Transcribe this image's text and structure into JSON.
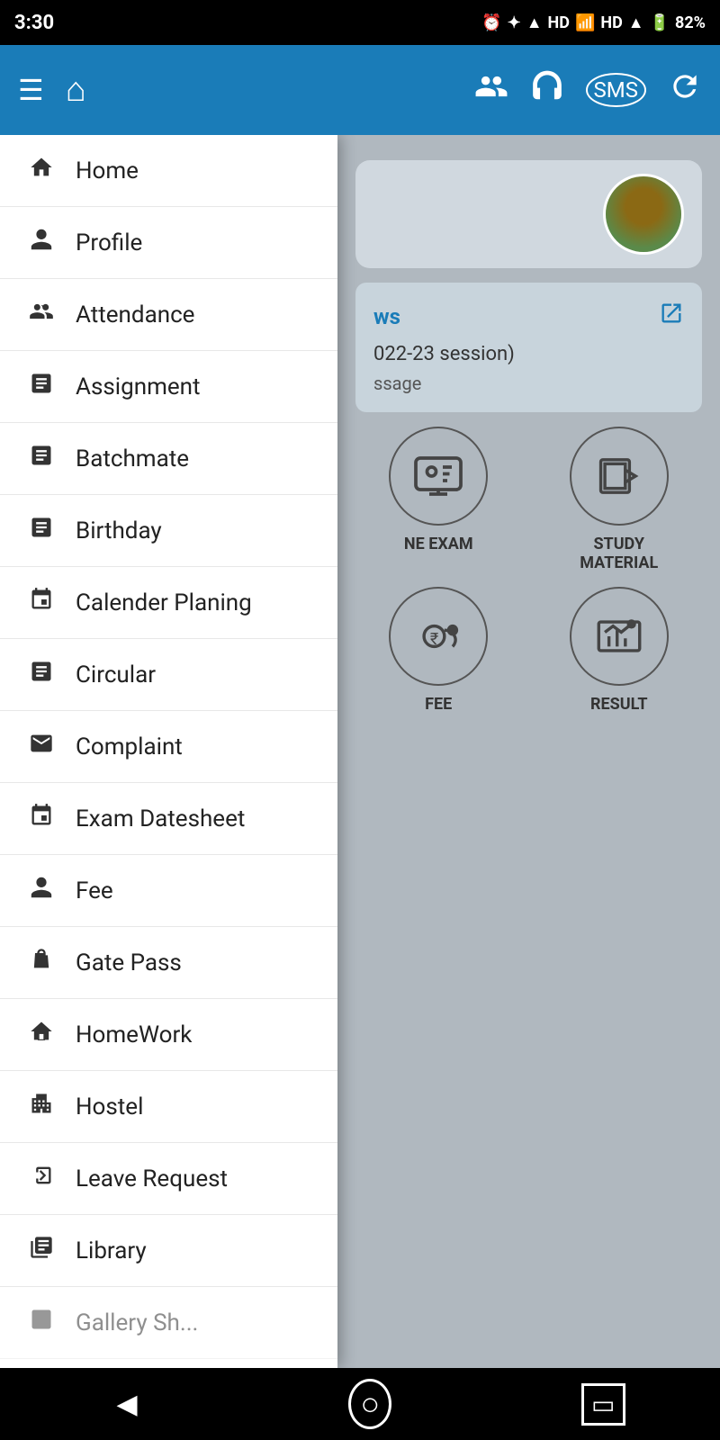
{
  "status_bar": {
    "time": "3:30",
    "battery": "82%",
    "signal": "HD"
  },
  "app_bar": {
    "menu_icon": "☰",
    "home_icon": "⌂"
  },
  "nav_items": [
    {
      "id": "home",
      "label": "Home",
      "icon": "🏠"
    },
    {
      "id": "profile",
      "label": "Profile",
      "icon": "👤"
    },
    {
      "id": "attendance",
      "label": "Attendance",
      "icon": "👥"
    },
    {
      "id": "assignment",
      "label": "Assignment",
      "icon": "📋"
    },
    {
      "id": "batchmate",
      "label": "Batchmate",
      "icon": "📋"
    },
    {
      "id": "birthday",
      "label": "Birthday",
      "icon": "📋"
    },
    {
      "id": "calender-planing",
      "label": "Calender Planing",
      "icon": "📅"
    },
    {
      "id": "circular",
      "label": "Circular",
      "icon": "📋"
    },
    {
      "id": "complaint",
      "label": "Complaint",
      "icon": "✉"
    },
    {
      "id": "exam-datesheet",
      "label": "Exam Datesheet",
      "icon": "📅"
    },
    {
      "id": "fee",
      "label": "Fee",
      "icon": "👤"
    },
    {
      "id": "gate-pass",
      "label": "Gate Pass",
      "icon": "✋"
    },
    {
      "id": "homework",
      "label": "HomeWork",
      "icon": "🏠"
    },
    {
      "id": "hostel",
      "label": "Hostel",
      "icon": "🏢"
    },
    {
      "id": "leave-request",
      "label": "Leave Request",
      "icon": "➡"
    },
    {
      "id": "library",
      "label": "Library",
      "icon": "📚"
    }
  ],
  "news_card": {
    "title": "ws",
    "session_text": "022-23 session)",
    "body_text": "ssage"
  },
  "quick_actions_row1": [
    {
      "id": "online-exam",
      "label": "NE EXAM"
    },
    {
      "id": "study-material",
      "label": "STUDY\nMATERIAL"
    }
  ],
  "quick_actions_row2": [
    {
      "id": "fee",
      "label": "FEE"
    },
    {
      "id": "result",
      "label": "RESULT"
    }
  ],
  "bottom_nav": {
    "back": "◀",
    "home": "⬤",
    "square": "■"
  }
}
